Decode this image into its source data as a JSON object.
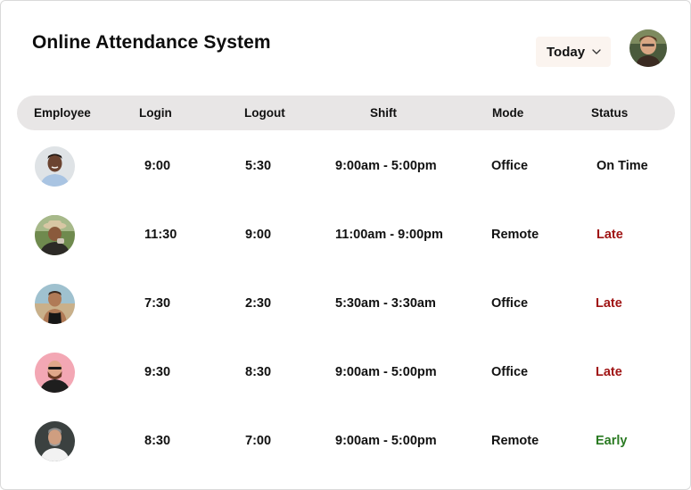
{
  "header": {
    "title": "Online Attendance System",
    "date_filter": {
      "label": "Today",
      "icon": "chevron-down-icon"
    },
    "user_avatar": "user-avatar"
  },
  "table": {
    "columns": [
      "Employee",
      "Login",
      "Logout",
      "Shift",
      "Mode",
      "Status"
    ],
    "rows": [
      {
        "avatar": "employee-avatar",
        "login": "9:00",
        "logout": "5:30",
        "shift": "9:00am - 5:00pm",
        "mode": "Office",
        "status": "On Time",
        "status_color": "#111111"
      },
      {
        "avatar": "employee-avatar",
        "login": "11:30",
        "logout": "9:00",
        "shift": "11:00am - 9:00pm",
        "mode": "Remote",
        "status": "Late",
        "status_color": "#a01515"
      },
      {
        "avatar": "employee-avatar",
        "login": "7:30",
        "logout": "2:30",
        "shift": "5:30am - 3:30am",
        "mode": "Office",
        "status": "Late",
        "status_color": "#a01515"
      },
      {
        "avatar": "employee-avatar",
        "login": "9:30",
        "logout": "8:30",
        "shift": "9:00am - 5:00pm",
        "mode": "Office",
        "status": "Late",
        "status_color": "#a01515"
      },
      {
        "avatar": "employee-avatar",
        "login": "8:30",
        "logout": "7:00",
        "shift": "9:00am - 5:00pm",
        "mode": "Remote",
        "status": "Early",
        "status_color": "#2a7a22"
      }
    ]
  },
  "colors": {
    "late": "#a01515",
    "early": "#2a7a22",
    "on_time": "#111111",
    "header_bg": "#e8e6e6",
    "filter_bg": "#fbf4ef"
  }
}
